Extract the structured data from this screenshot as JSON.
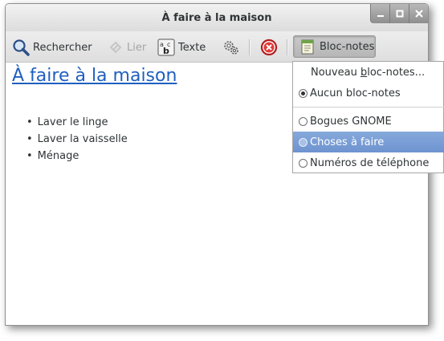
{
  "window": {
    "title": "À faire à la maison"
  },
  "toolbar": {
    "search_label": "Rechercher",
    "link_label": "Lier",
    "text_label": "Texte",
    "notebook_label": "Bloc-notes"
  },
  "note": {
    "title": "À faire à la maison",
    "items": [
      "Laver le linge",
      "Laver la vaisselle",
      "Ménage"
    ]
  },
  "notebook_menu": {
    "new_notebook_prefix": "Nouveau ",
    "new_notebook_mnemonic": "b",
    "new_notebook_suffix": "loc-notes...",
    "options": [
      {
        "label": "Aucun bloc-notes",
        "selected": true
      },
      {
        "label": "Bogues GNOME",
        "selected": false
      },
      {
        "label": "Choses à faire",
        "selected": false,
        "highlighted": true
      },
      {
        "label": "Numéros de téléphone",
        "selected": false
      }
    ]
  },
  "colors": {
    "highlight": "#7a9fd8",
    "link": "#1f5fbf"
  }
}
